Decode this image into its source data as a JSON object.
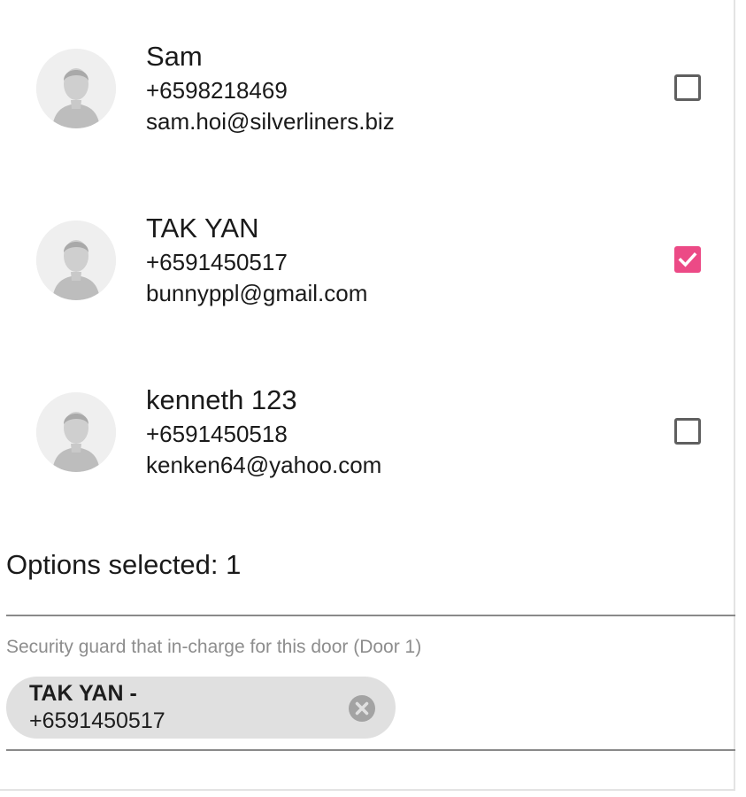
{
  "contacts": [
    {
      "name": "Sam",
      "phone": "+6598218469",
      "email": "sam.hoi@silverliners.biz",
      "checked": false
    },
    {
      "name": "TAK YAN",
      "phone": "+6591450517",
      "email": "bunnyppl@gmail.com",
      "checked": true
    },
    {
      "name": "kenneth 123",
      "phone": "+6591450518",
      "email": "kenken64@yahoo.com",
      "checked": false
    }
  ],
  "selection": {
    "summary": "Options selected: 1"
  },
  "assignment": {
    "label": "Security guard that in-charge for this door (Door 1)",
    "chip_line1": "TAK YAN -",
    "chip_line2": "+6591450517"
  },
  "colors": {
    "accent": "#ec4a86",
    "chip_bg": "#e0e0e0",
    "label_text": "#8d8d8d"
  },
  "icons": {
    "avatar": "person-silhouette-icon",
    "checkbox_checked": "checkmark-icon",
    "chip_remove": "cancel-circle-icon"
  }
}
